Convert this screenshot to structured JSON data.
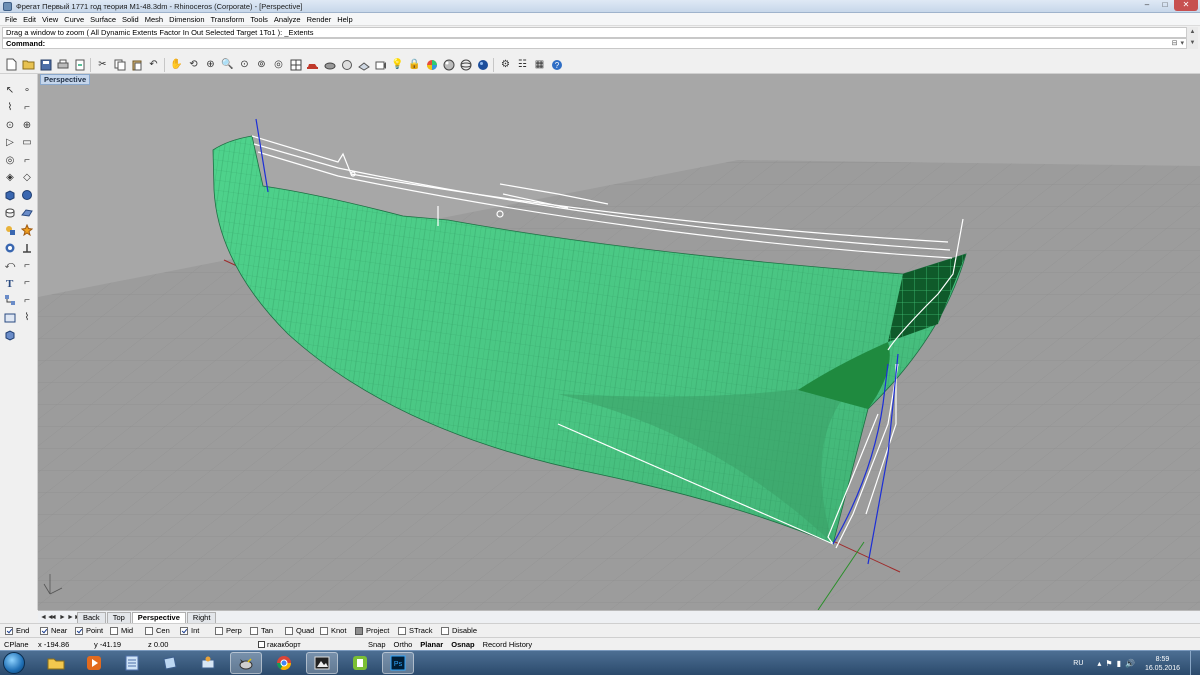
{
  "window": {
    "title": "Фрегат Первый 1771 год теория М1-48.3dm - Rhinoceros (Corporate) - [Perspective]",
    "controls": {
      "minimize": "–",
      "maximize": "□",
      "close": "✕"
    }
  },
  "menu": [
    "File",
    "Edit",
    "View",
    "Curve",
    "Surface",
    "Solid",
    "Mesh",
    "Dimension",
    "Transform",
    "Tools",
    "Analyze",
    "Render",
    "Help"
  ],
  "command": {
    "history": "Drag a window to zoom ( All  Dynamic  Extents  Factor  In  Out  Selected  Target  1To1 ): _Extents",
    "prompt": "Command:"
  },
  "toolbar_icons": [
    "new-file",
    "open-file",
    "save-file",
    "print",
    "export",
    "cut",
    "copy",
    "paste",
    "undo",
    "pan",
    "rotate-view",
    "zoom-window",
    "zoom-dynamic",
    "zoom-extents",
    "zoom-selected",
    "zoom-all",
    "four-viewports",
    "car-object",
    "shade",
    "render-preview",
    "construction-plane",
    "named-views",
    "light-bulb",
    "lock",
    "color-wheel",
    "material",
    "sphere",
    "render-globe",
    "settings",
    "options",
    "grid-settings",
    "help"
  ],
  "left_tools": [
    "select-arrow",
    "point",
    "polyline",
    "curve-point",
    "circle",
    "arc-rotate",
    "polygon",
    "rectangle",
    "curve-edit",
    "fillet",
    "surface-box",
    "surface-loft",
    "solid-box",
    "solid-sphere",
    "extrude",
    "planar-surface",
    "transform-move",
    "explode",
    "boolean",
    "join",
    "dimension",
    "text",
    "curve-from-object",
    "hatch",
    "gumball",
    "offset",
    "layout",
    "drafting",
    "mesh-tools",
    "render-tools"
  ],
  "viewport": {
    "label": "Perspective",
    "hull_color": "#4cc583",
    "background": "#a7a7a7"
  },
  "viewport_tabs": {
    "nav": [
      "◄◄",
      "◄",
      "►",
      "►►"
    ],
    "tabs": [
      {
        "label": "Back",
        "active": false
      },
      {
        "label": "Top",
        "active": false
      },
      {
        "label": "Perspective",
        "active": true
      },
      {
        "label": "Right",
        "active": false
      }
    ]
  },
  "osnap": [
    {
      "label": "End",
      "checked": true
    },
    {
      "label": "Near",
      "checked": true
    },
    {
      "label": "Point",
      "checked": true
    },
    {
      "label": "Mid",
      "checked": false
    },
    {
      "label": "Cen",
      "checked": false
    },
    {
      "label": "Int",
      "checked": true
    },
    {
      "label": "Perp",
      "checked": false
    },
    {
      "label": "Tan",
      "checked": false
    },
    {
      "label": "Quad",
      "checked": false
    },
    {
      "label": "Knot",
      "checked": false
    },
    {
      "label": "Project",
      "checked": true
    },
    {
      "label": "STrack",
      "checked": false
    },
    {
      "label": "Disable",
      "checked": false
    }
  ],
  "status": {
    "cplane": "CPlane",
    "x": "x -194.86",
    "y": "y -41.19",
    "z": "z 0.00",
    "layer": "гакакборт",
    "toggles": [
      "Snap",
      "Ortho",
      "Planar",
      "Osnap",
      "Record History"
    ],
    "bold_toggles": [
      "Planar",
      "Osnap"
    ]
  },
  "taskbar": {
    "apps": [
      "explorer",
      "media-player",
      "notepad",
      "sticky-notes",
      "files",
      "rhino",
      "chrome",
      "screenshot",
      "greenshot",
      "photoshop"
    ],
    "lang": "RU",
    "time": "8:59",
    "date": "16.05.2016"
  }
}
